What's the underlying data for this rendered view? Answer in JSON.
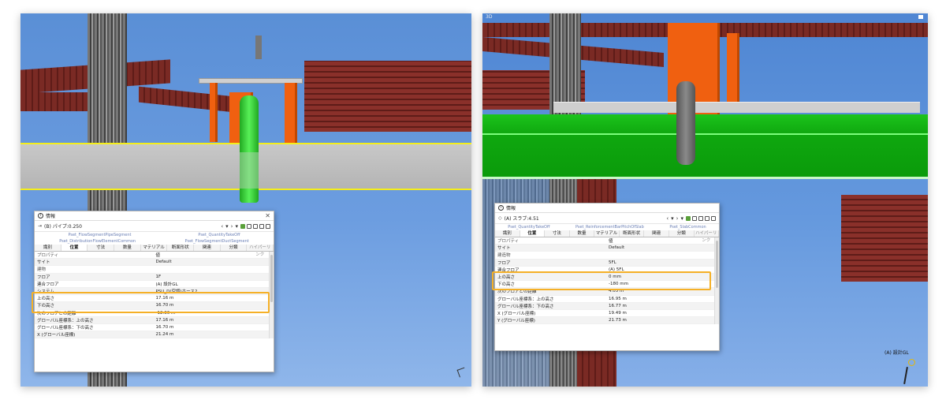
{
  "left": {
    "panel": {
      "title": "情報",
      "element": "(B) パイプ:0.250",
      "psets": [
        "Pset_FlowSegmentPipeSegment",
        "Pset_QuantityTakeOff",
        "Pset_DistributionFlowElementCommon",
        "Pset_FlowSegmentDuctSegment"
      ],
      "tabs": [
        "識別",
        "位置",
        "寸法",
        "数量",
        "マテリアル",
        "断面形状",
        "関連",
        "分類",
        "ハイパーリンク"
      ],
      "active_tab": "位置",
      "rows": [
        {
          "k": "プロパティ",
          "v": "値"
        },
        {
          "k": "サイト",
          "v": "Default"
        },
        {
          "k": "建物",
          "v": ""
        },
        {
          "k": "フロア",
          "v": "1F"
        },
        {
          "k": "連合フロア",
          "v": "(A) 設計GL"
        },
        {
          "k": "システム",
          "v": "PSU_D(空調)ホース2"
        },
        {
          "k": "上の高さ",
          "v": "17.16 m"
        },
        {
          "k": "下の高さ",
          "v": "16.70 m"
        },
        {
          "k": "次のフロアとの距離",
          "v": "-12.36 m"
        },
        {
          "k": "グローバル座標系：上の高さ",
          "v": "17.16 m"
        },
        {
          "k": "グローバル座標系：下の高さ",
          "v": "16.70 m"
        },
        {
          "k": "X (グローバル座標)",
          "v": "21.24 m"
        }
      ]
    }
  },
  "right": {
    "window_label": "3D",
    "panel": {
      "title": "情報",
      "element": "(A) スラブ:4.51",
      "psets": [
        "Pset_QuantityTakeOff",
        "Pset_ReinforcementBarPitchOfSlab",
        "Pset_SlabCommon"
      ],
      "tabs": [
        "識別",
        "位置",
        "寸法",
        "数量",
        "マテリアル",
        "断面形状",
        "関連",
        "分類",
        "ハイパーリンク"
      ],
      "active_tab": "位置",
      "rows": [
        {
          "k": "プロパティ",
          "v": "値"
        },
        {
          "k": "サイト",
          "v": "Default"
        },
        {
          "k": "建造物",
          "v": ""
        },
        {
          "k": "フロア",
          "v": "5FL"
        },
        {
          "k": "連合フロア",
          "v": "(A) 5FL"
        },
        {
          "k": "上の高さ",
          "v": "0 mm"
        },
        {
          "k": "下の高さ",
          "v": "-180 mm"
        },
        {
          "k": "次のフロアとの距離",
          "v": "4.05 m"
        },
        {
          "k": "グローバル座標系：上の高さ",
          "v": "16.95 m"
        },
        {
          "k": "グローバル座標系：下の高さ",
          "v": "16.77 m"
        },
        {
          "k": "X (グローバル座標)",
          "v": "19.49 m"
        },
        {
          "k": "Y (グローバル座標)",
          "v": "21.73 m"
        }
      ]
    },
    "compass_label": "(A) 設計GL"
  },
  "colors": {
    "highlight": "#f5b027",
    "pipe": "#3ad13a",
    "slab": "#0fa10f",
    "steel": "#7a2a24",
    "orange": "#f06010"
  }
}
